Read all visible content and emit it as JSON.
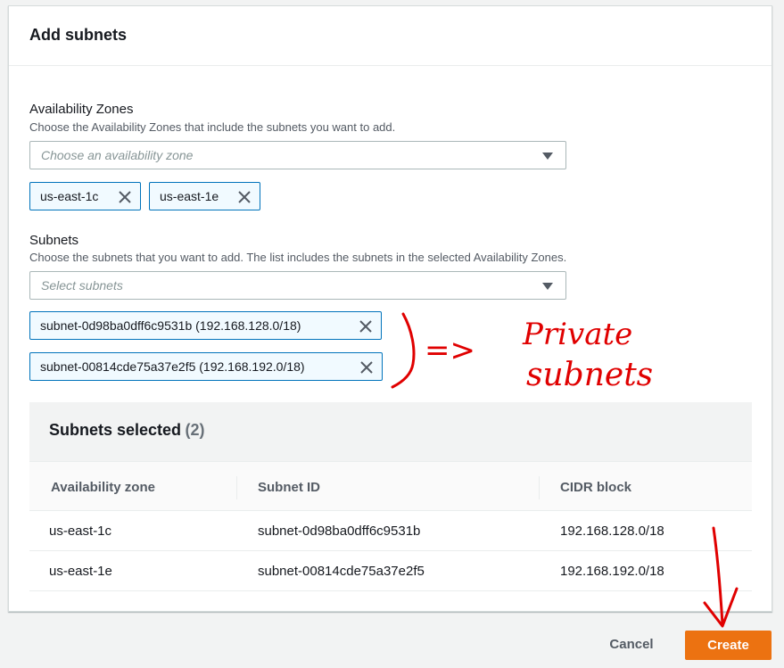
{
  "panel": {
    "title": "Add subnets"
  },
  "availability_zones": {
    "label": "Availability Zones",
    "description": "Choose the Availability Zones that include the subnets you want to add.",
    "placeholder": "Choose an availability zone",
    "tokens": [
      "us-east-1c",
      "us-east-1e"
    ]
  },
  "subnets": {
    "label": "Subnets",
    "description": "Choose the subnets that you want to add. The list includes the subnets in the selected Availability Zones.",
    "placeholder": "Select subnets",
    "tokens": [
      "subnet-0d98ba0dff6c9531b (192.168.128.0/18)",
      "subnet-00814cde75a37e2f5 (192.168.192.0/18)"
    ]
  },
  "selected_table": {
    "title": "Subnets selected",
    "count": "(2)",
    "columns": [
      "Availability zone",
      "Subnet ID",
      "CIDR block"
    ],
    "rows": [
      {
        "az": "us-east-1c",
        "subnet_id": "subnet-0d98ba0dff6c9531b",
        "cidr": "192.168.128.0/18"
      },
      {
        "az": "us-east-1e",
        "subnet_id": "subnet-00814cde75a37e2f5",
        "cidr": "192.168.192.0/18"
      }
    ]
  },
  "footer": {
    "cancel_label": "Cancel",
    "create_label": "Create"
  },
  "annotation": {
    "arrow_text": "=>",
    "note_line1": "Private",
    "note_line2": "subnets"
  },
  "colors": {
    "accent": "#ec7211",
    "token_border": "#0073bb",
    "annotation": "#e00000"
  }
}
